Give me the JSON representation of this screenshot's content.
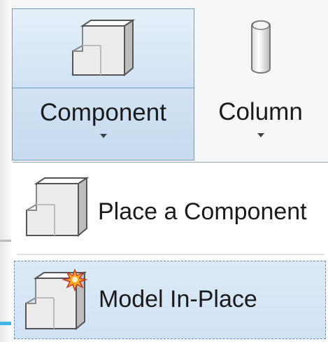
{
  "ribbon": {
    "component_button": {
      "label": "Component",
      "icon": "component-icon"
    },
    "column_button": {
      "label": "Column",
      "icon": "column-icon"
    }
  },
  "dropdown": {
    "items": [
      {
        "label": "Place a Component",
        "icon": "component-icon"
      },
      {
        "label": "Model In-Place",
        "icon": "model-in-place-icon",
        "highlighted": true
      }
    ]
  },
  "colors": {
    "selection": "#cfe2f4",
    "border": "#6e9cc6",
    "text": "#1b1b1b",
    "burst": "#f5a623"
  }
}
